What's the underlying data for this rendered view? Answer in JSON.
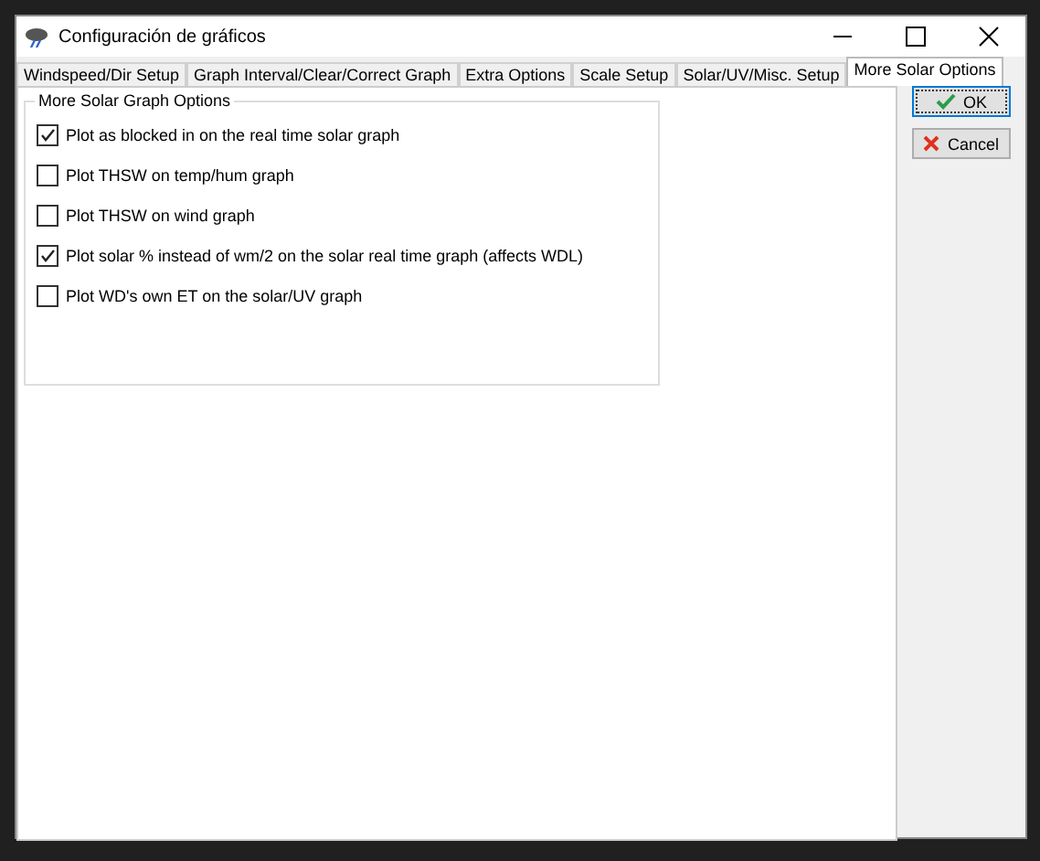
{
  "window": {
    "title": "Configuración de gráficos"
  },
  "tabs": [
    {
      "label": "Windspeed/Dir Setup",
      "selected": false
    },
    {
      "label": "Graph Interval/Clear/Correct Graph",
      "selected": false
    },
    {
      "label": "Extra Options",
      "selected": false
    },
    {
      "label": "Scale Setup",
      "selected": false
    },
    {
      "label": "Solar/UV/Misc. Setup",
      "selected": false
    },
    {
      "label": "More Solar Options",
      "selected": true
    }
  ],
  "group": {
    "title": "More Solar Graph Options",
    "options": [
      {
        "label": "Plot as blocked in on the real time solar graph",
        "checked": true
      },
      {
        "label": "Plot THSW on temp/hum graph",
        "checked": false
      },
      {
        "label": "Plot THSW on wind graph",
        "checked": false
      },
      {
        "label": "Plot solar % instead of wm/2 on the solar real time graph (affects WDL)",
        "checked": true
      },
      {
        "label": "Plot WD's own ET on the solar/UV graph",
        "checked": false
      }
    ]
  },
  "buttons": [
    {
      "kind": "ok",
      "label": "OK"
    },
    {
      "kind": "cancel",
      "label": "Cancel"
    }
  ]
}
